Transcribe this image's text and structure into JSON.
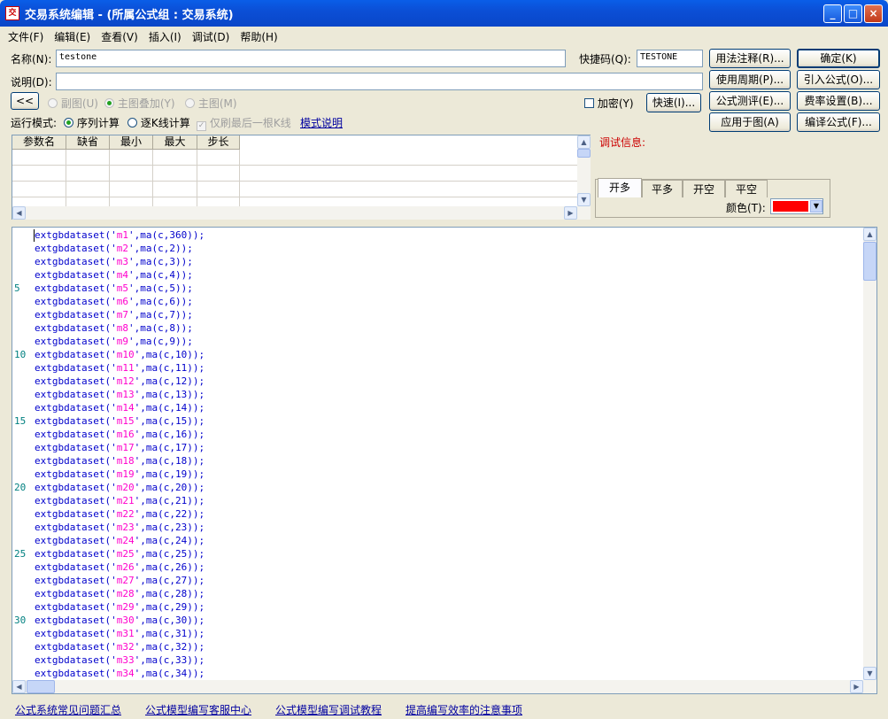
{
  "window": {
    "title": "交易系统编辑 - (所属公式组 : 交易系统)",
    "app_icon_text": "交",
    "btn_min": "_",
    "btn_max": "□",
    "btn_close": "×"
  },
  "menu": [
    "文件(F)",
    "编辑(E)",
    "查看(V)",
    "插入(I)",
    "调试(D)",
    "帮助(H)"
  ],
  "form": {
    "name_label": "名称(N):",
    "name_value": "testone",
    "shortcut_label": "快捷码(Q):",
    "shortcut_value": "TESTONE",
    "desc_label": "说明(D):",
    "desc_value": "",
    "collapse_button": "<<",
    "radio_subchart": "副图(U)",
    "radio_overlay": "主图叠加(Y)",
    "radio_main": "主图(M)",
    "encrypt_label": "加密(Y)",
    "fast_button": "快速(I)...",
    "run_mode_label": "运行模式:",
    "run_mode_seq": "序列计算",
    "run_mode_kline": "逐K线计算",
    "last_kline_only": "仅刷最后一根K线",
    "mode_help_link": "模式说明"
  },
  "buttons": {
    "usage_notes": "用法注释(R)...",
    "use_period": "使用周期(P)...",
    "formula_eval": "公式测评(E)...",
    "apply_to_chart": "应用于图(A)",
    "ok": "确定(K)",
    "import_formula": "引入公式(O)...",
    "fee_settings": "费率设置(B)...",
    "compile_formula": "编译公式(F)..."
  },
  "param_grid": {
    "headers": [
      "参数名",
      "缺省",
      "最小",
      "最大",
      "步长"
    ]
  },
  "debug": {
    "label": "调试信息:",
    "tabs": [
      "开多",
      "平多",
      "开空",
      "平空"
    ],
    "active_tab": 0,
    "color_label": "颜色(T):",
    "color_value": "#ff0000"
  },
  "editor": {
    "lines": [
      {
        "n": "",
        "name": "m1",
        "arg": "360"
      },
      {
        "n": "",
        "name": "m2",
        "arg": "2"
      },
      {
        "n": "",
        "name": "m3",
        "arg": "3"
      },
      {
        "n": "",
        "name": "m4",
        "arg": "4"
      },
      {
        "n": "5",
        "name": "m5",
        "arg": "5"
      },
      {
        "n": "",
        "name": "m6",
        "arg": "6"
      },
      {
        "n": "",
        "name": "m7",
        "arg": "7"
      },
      {
        "n": "",
        "name": "m8",
        "arg": "8"
      },
      {
        "n": "",
        "name": "m9",
        "arg": "9"
      },
      {
        "n": "10",
        "name": "m10",
        "arg": "10"
      },
      {
        "n": "",
        "name": "m11",
        "arg": "11"
      },
      {
        "n": "",
        "name": "m12",
        "arg": "12"
      },
      {
        "n": "",
        "name": "m13",
        "arg": "13"
      },
      {
        "n": "",
        "name": "m14",
        "arg": "14"
      },
      {
        "n": "15",
        "name": "m15",
        "arg": "15"
      },
      {
        "n": "",
        "name": "m16",
        "arg": "16"
      },
      {
        "n": "",
        "name": "m17",
        "arg": "17"
      },
      {
        "n": "",
        "name": "m18",
        "arg": "18"
      },
      {
        "n": "",
        "name": "m19",
        "arg": "19"
      },
      {
        "n": "20",
        "name": "m20",
        "arg": "20"
      },
      {
        "n": "",
        "name": "m21",
        "arg": "21"
      },
      {
        "n": "",
        "name": "m22",
        "arg": "22"
      },
      {
        "n": "",
        "name": "m23",
        "arg": "23"
      },
      {
        "n": "",
        "name": "m24",
        "arg": "24"
      },
      {
        "n": "25",
        "name": "m25",
        "arg": "25"
      },
      {
        "n": "",
        "name": "m26",
        "arg": "26"
      },
      {
        "n": "",
        "name": "m27",
        "arg": "27"
      },
      {
        "n": "",
        "name": "m28",
        "arg": "28"
      },
      {
        "n": "",
        "name": "m29",
        "arg": "29"
      },
      {
        "n": "30",
        "name": "m30",
        "arg": "30"
      },
      {
        "n": "",
        "name": "m31",
        "arg": "31"
      },
      {
        "n": "",
        "name": "m32",
        "arg": "32"
      },
      {
        "n": "",
        "name": "m33",
        "arg": "33"
      },
      {
        "n": "",
        "name": "m34",
        "arg": "34"
      }
    ]
  },
  "footer": {
    "links": [
      "公式系统常见问题汇总",
      "公式模型编写客服中心",
      "公式模型编写调试教程",
      "提高编写效率的注意事项"
    ]
  }
}
